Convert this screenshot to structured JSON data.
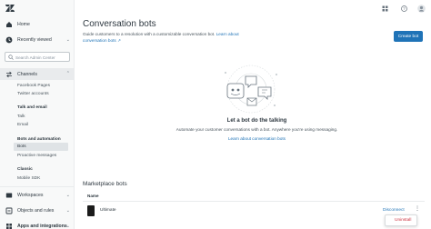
{
  "sidebar": {
    "nav": [
      {
        "label": "Home",
        "icon": "home-icon"
      },
      {
        "label": "Recently viewed",
        "icon": "clock-icon"
      }
    ],
    "search_placeholder": "Search Admin Center",
    "channels_label": "Channels",
    "channels_groups": {
      "g1_items": [
        "Facebook Pages",
        "Twitter accounts"
      ],
      "g2_title": "Talk and email",
      "g2_items": [
        "Talk",
        "Email"
      ],
      "g3_title": "Bots and automation",
      "g3_items": [
        "Bots",
        "Proactive messages"
      ],
      "g4_title": "Classic",
      "g4_items": [
        "Mobile SDK"
      ]
    },
    "bottom_nav": [
      "Workspaces",
      "Objects and rules",
      "Apps and integrations"
    ]
  },
  "header": {
    "title": "Conversation bots",
    "description": "Guide customers to a resolution with a customizable conversation bot.",
    "link": "Learn about conversation bots",
    "create_button": "Create bot"
  },
  "empty_state": {
    "title": "Let a bot do the talking",
    "description": "Automate your customer conversations with a bot. Anywhere you're using messaging.",
    "link": "Learn about conversation bots"
  },
  "marketplace": {
    "title": "Marketplace bots",
    "column_name": "Name",
    "rows": [
      {
        "name": "Ultimate",
        "action": "Disconnect"
      }
    ],
    "menu_item": "Uninstall"
  },
  "colors": {
    "brand": "#1f73b7",
    "danger": "#cc3340"
  }
}
